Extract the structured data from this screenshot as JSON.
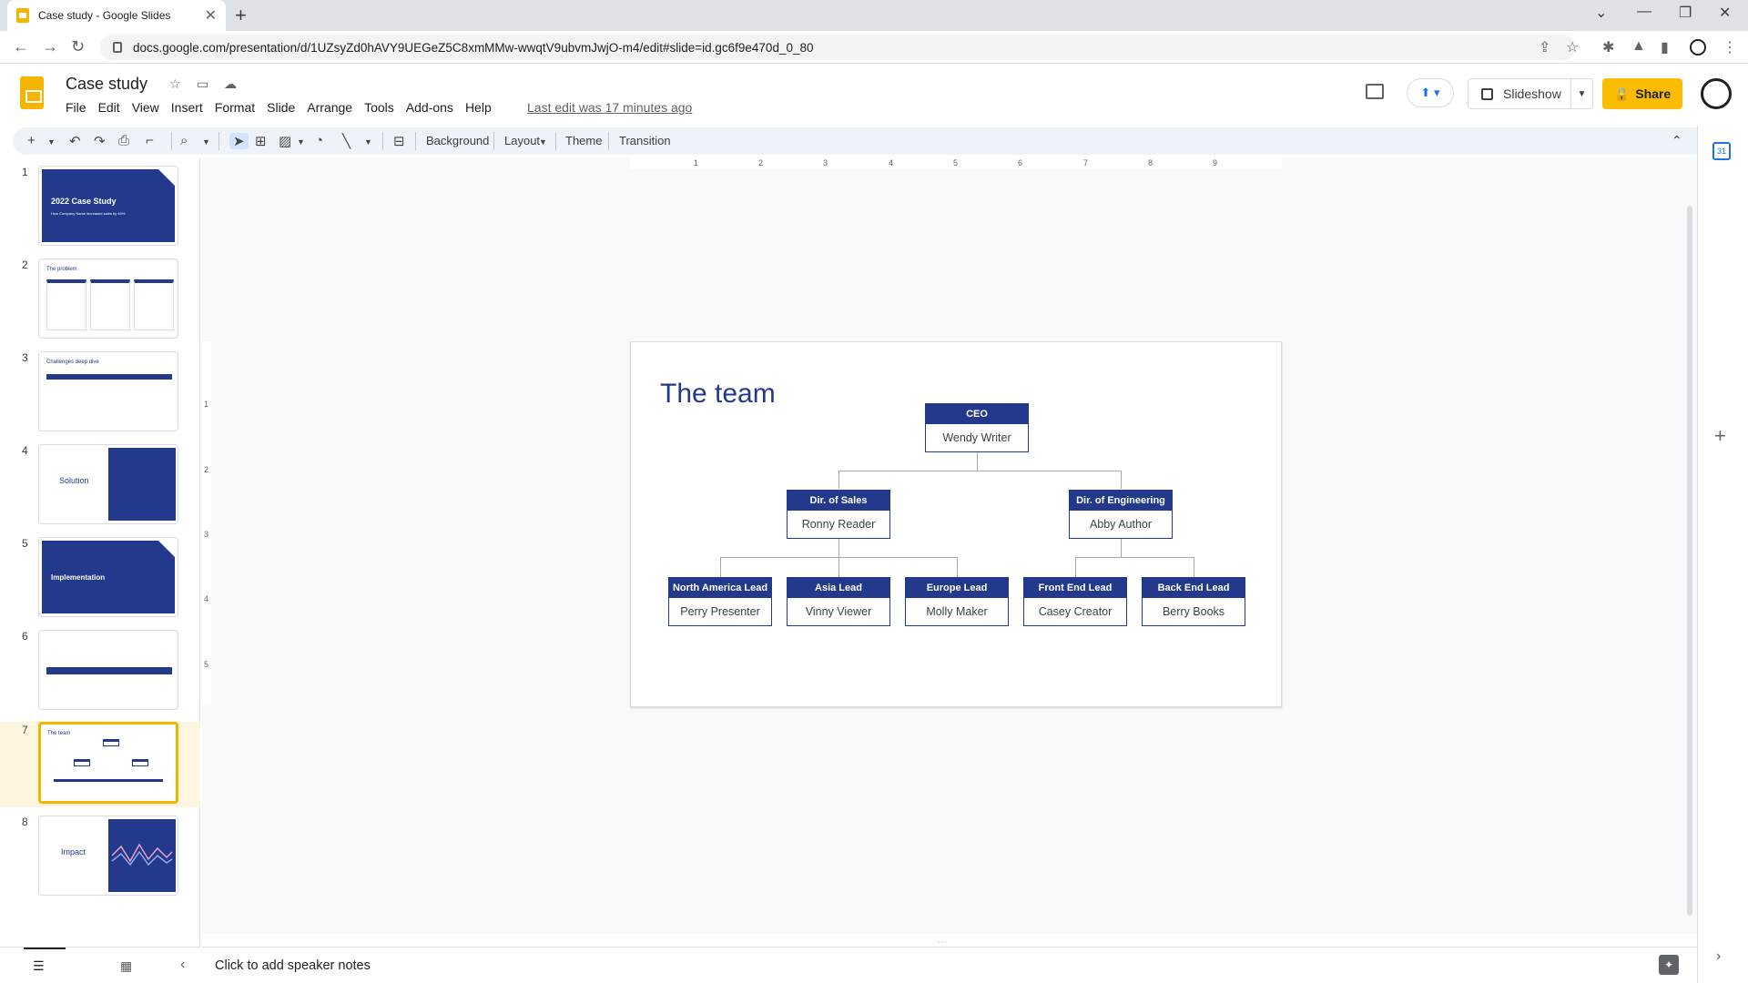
{
  "browser": {
    "tab_title": "Case study - Google Slides",
    "url": "docs.google.com/presentation/d/1UZsyZd0hAVY9UEGeZ5C8xmMMw-wwqtV9ubvmJwjO-m4/edit#slide=id.gc6f9e470d_0_80"
  },
  "doc": {
    "title": "Case study",
    "menus": [
      "File",
      "Edit",
      "View",
      "Insert",
      "Format",
      "Slide",
      "Arrange",
      "Tools",
      "Add-ons",
      "Help"
    ],
    "last_edit": "Last edit was 17 minutes ago",
    "slideshow_label": "Slideshow",
    "share_label": "Share"
  },
  "toolbar": {
    "background": "Background",
    "layout": "Layout",
    "theme": "Theme",
    "transition": "Transition"
  },
  "filmstrip": {
    "slides": [
      {
        "num": "1",
        "title": "2022 Case Study",
        "subtitle": "How Company Name increased sales by 40%"
      },
      {
        "num": "2",
        "title": "The problem"
      },
      {
        "num": "3",
        "title": "Challenges deep dive"
      },
      {
        "num": "4",
        "title": "Solution"
      },
      {
        "num": "5",
        "title": "Implementation"
      },
      {
        "num": "6"
      },
      {
        "num": "7",
        "title": "The team"
      },
      {
        "num": "8",
        "title": "Impact"
      }
    ]
  },
  "ruler": {
    "h": [
      "1",
      "2",
      "3",
      "4",
      "5",
      "6",
      "7",
      "8",
      "9"
    ],
    "v": [
      "1",
      "2",
      "3",
      "4",
      "5"
    ]
  },
  "slide": {
    "title": "The team",
    "org": {
      "ceo": {
        "role": "CEO",
        "person": "Wendy Writer"
      },
      "sales": {
        "role": "Dir. of Sales",
        "person": "Ronny Reader"
      },
      "eng": {
        "role": "Dir. of Engineering",
        "person": "Abby Author"
      },
      "na": {
        "role": "North America Lead",
        "person": "Perry Presenter"
      },
      "asia": {
        "role": "Asia Lead",
        "person": "Vinny Viewer"
      },
      "europe": {
        "role": "Europe Lead",
        "person": "Molly Maker"
      },
      "frontend": {
        "role": "Front End Lead",
        "person": "Casey Creator"
      },
      "backend": {
        "role": "Back End Lead",
        "person": "Berry Books"
      }
    }
  },
  "notes": {
    "placeholder": "Click to add speaker notes"
  },
  "colors": {
    "accent": "#233a8c",
    "share": "#fbbc04",
    "selected": "#f4b400"
  }
}
